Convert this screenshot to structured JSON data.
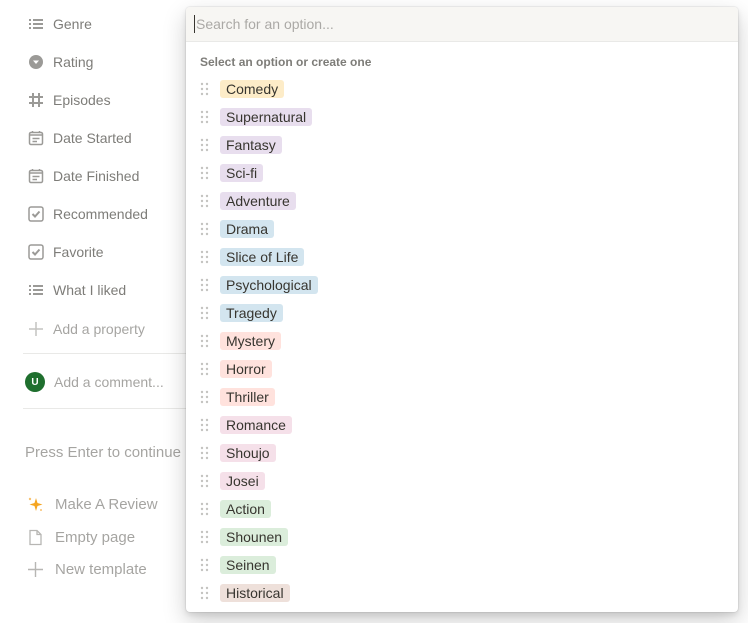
{
  "properties": [
    {
      "label": "Genre",
      "icon": "list-icon"
    },
    {
      "label": "Rating",
      "icon": "select-icon"
    },
    {
      "label": "Episodes",
      "icon": "number-icon"
    },
    {
      "label": "Date Started",
      "icon": "calendar-icon"
    },
    {
      "label": "Date Finished",
      "icon": "calendar-icon"
    },
    {
      "label": "Recommended",
      "icon": "checkbox-icon"
    },
    {
      "label": "Favorite",
      "icon": "checkbox-icon"
    },
    {
      "label": "What I liked",
      "icon": "list-icon"
    }
  ],
  "add_property_label": "Add a property",
  "comment": {
    "avatar_initial": "U",
    "placeholder": "Add a comment..."
  },
  "enter_hint": "Press Enter to continue",
  "templates": [
    {
      "label": "Make A Review",
      "icon": "sparkle-icon"
    },
    {
      "label": "Empty page",
      "icon": "page-icon"
    },
    {
      "label": "New template",
      "icon": "plus-icon"
    }
  ],
  "dropdown": {
    "search_placeholder": "Search for an option...",
    "search_value": "",
    "hint": "Select an option or create one",
    "options": [
      {
        "label": "Comedy",
        "color": "#fdecc8"
      },
      {
        "label": "Supernatural",
        "color": "#e8deee"
      },
      {
        "label": "Fantasy",
        "color": "#e8deee"
      },
      {
        "label": "Sci-fi",
        "color": "#e8deee"
      },
      {
        "label": "Adventure",
        "color": "#e8deee"
      },
      {
        "label": "Drama",
        "color": "#d3e5ef"
      },
      {
        "label": "Slice of Life",
        "color": "#d3e5ef"
      },
      {
        "label": "Psychological",
        "color": "#d3e5ef"
      },
      {
        "label": "Tragedy",
        "color": "#d3e5ef"
      },
      {
        "label": "Mystery",
        "color": "#ffe2dd"
      },
      {
        "label": "Horror",
        "color": "#ffe2dd"
      },
      {
        "label": "Thriller",
        "color": "#ffe2dd"
      },
      {
        "label": "Romance",
        "color": "#f5e0e9"
      },
      {
        "label": "Shoujo",
        "color": "#f5e0e9"
      },
      {
        "label": "Josei",
        "color": "#f5e0e9"
      },
      {
        "label": "Action",
        "color": "#dbeddb"
      },
      {
        "label": "Shounen",
        "color": "#dbeddb"
      },
      {
        "label": "Seinen",
        "color": "#dbeddb"
      },
      {
        "label": "Historical",
        "color": "#eee0da"
      }
    ]
  }
}
